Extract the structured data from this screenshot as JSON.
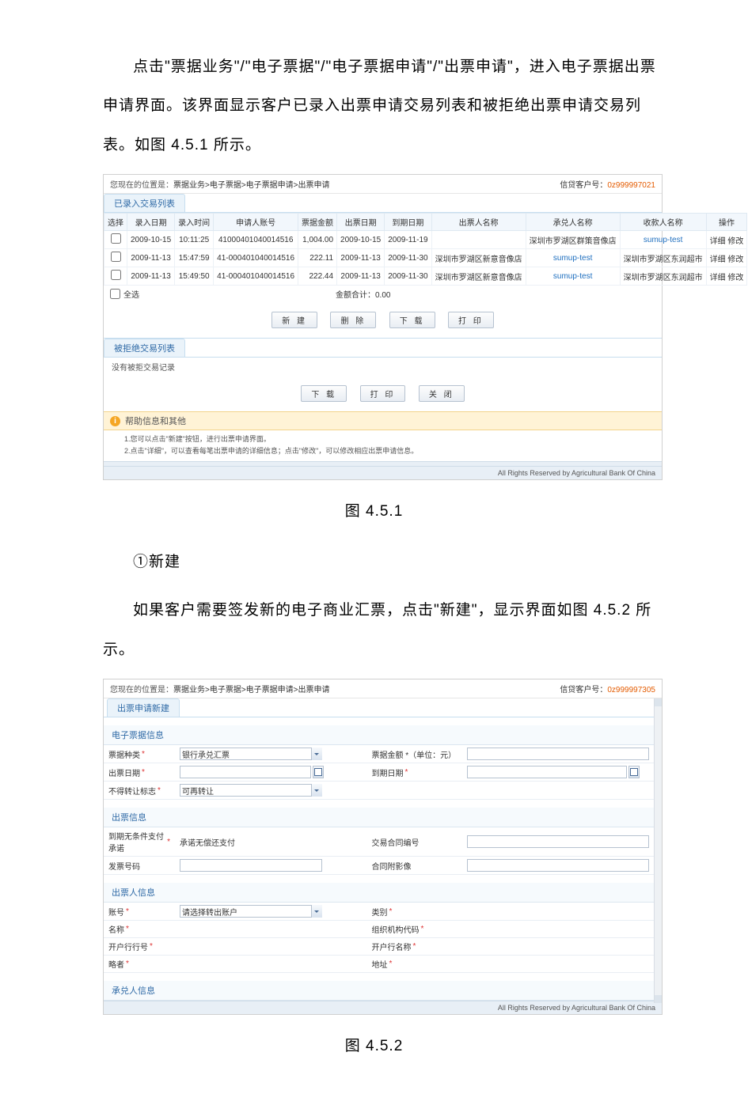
{
  "para1": "点击\"票据业务\"/\"电子票据\"/\"电子票据申请\"/\"出票申请\"，进入电子票据出票申请界面。该界面显示客户已录入出票申请交易列表和被拒绝出票申请交易列表。如图 4.5.1 所示。",
  "fig1_caption": "图 4.5.1",
  "para2_title": "①新建",
  "para2": "如果客户需要签发新的电子商业汇票，点击\"新建\"，显示界面如图 4.5.2 所示。",
  "fig2_caption": "图 4.5.2",
  "scr1": {
    "loc_prefix": "您现在的位置是：",
    "loc_path": "票据业务>电子票据>电子票据申请>出票申请",
    "acct_label": "信贷客户号：",
    "acct_no": "0z999997021",
    "tab_entered": "已录入交易列表",
    "headers": [
      "选择",
      "录入日期",
      "录入时间",
      "申请人账号",
      "票据金额",
      "出票日期",
      "到期日期",
      "出票人名称",
      "承兑人名称",
      "收款人名称",
      "操作"
    ],
    "rows": [
      {
        "date": "2009-10-15",
        "time": "10:11:25",
        "acct": "41000401040014516",
        "amt": "1,004.00",
        "issue": "2009-10-15",
        "due": "2009-11-19",
        "drawer": "",
        "accp": "深圳市罗湖区群策音像店",
        "payee": "sumup-test"
      },
      {
        "date": "2009-11-13",
        "time": "15:47:59",
        "acct": "41-000401040014516",
        "amt": "222.11",
        "issue": "2009-11-13",
        "due": "2009-11-30",
        "drawer": "深圳市罗湖区新意音像店",
        "accp": "sumup-test",
        "payee": "深圳市罗湖区东润超市"
      },
      {
        "date": "2009-11-13",
        "time": "15:49:50",
        "acct": "41-000401040014516",
        "amt": "222.44",
        "issue": "2009-11-13",
        "due": "2009-11-30",
        "drawer": "深圳市罗湖区新意音像店",
        "accp": "sumup-test",
        "payee": "深圳市罗湖区东润超市"
      }
    ],
    "op_detail": "详细",
    "op_edit": "修改",
    "all_sel": "全选",
    "sum_label": "金额合计：0.00",
    "btns1": {
      "new": "新 建",
      "del": "删 除",
      "down": "下 载",
      "print": "打 印"
    },
    "tab_rejected": "被拒绝交易列表",
    "rej_empty": "没有被拒交易记录",
    "btns2": {
      "down": "下 载",
      "print": "打 印",
      "close": "关 闭"
    },
    "help_title": "帮助信息和其他",
    "help1": "1.您可以点击\"新建\"按钮，进行出票申请界面。",
    "help2": "2.点击\"详细\"，可以查看每笔出票申请的详细信息；点击\"修改\"，可以修改相应出票申请信息。",
    "footer": "All Rights Reserved by Agricultural Bank Of China"
  },
  "scr2": {
    "loc_prefix": "您现在的位置是：",
    "loc_path": "票据业务>电子票据>电子票据申请>出票申请",
    "acct_label": "信贷客户号：",
    "acct_no": "0z999997305",
    "tab": "出票申请新建",
    "sec1": "电子票据信息",
    "f_type_l": "票据种类",
    "f_type_v": "银行承兑汇票",
    "f_amt_l": "票据金额 *（单位：元）",
    "f_issue_l": "出票日期",
    "f_due_l": "到期日期",
    "f_trans_l": "不得转让标志",
    "f_trans_v": "可再转让",
    "sec2": "出票信息",
    "f_pay_l": "到期无条件支付承诺",
    "f_pay_v": "承诺无偿还支付",
    "f_trade_l": "交易合同编号",
    "f_inv_l": "发票号码",
    "f_contract_l": "合同附影像",
    "sec3": "出票人信息",
    "f_acc_l": "账号",
    "f_acc_v": "请选择转出账户",
    "f_cls_l": "类别",
    "f_name_l": "名称",
    "f_org_l": "组织机构代码",
    "f_bankno_l": "开户行行号",
    "f_bankname_l": "开户行名称",
    "f_rater_l": "略者",
    "f_addr_l": "地址",
    "sec4": "承兑人信息",
    "footer": "All Rights Reserved by Agricultural Bank Of China"
  }
}
